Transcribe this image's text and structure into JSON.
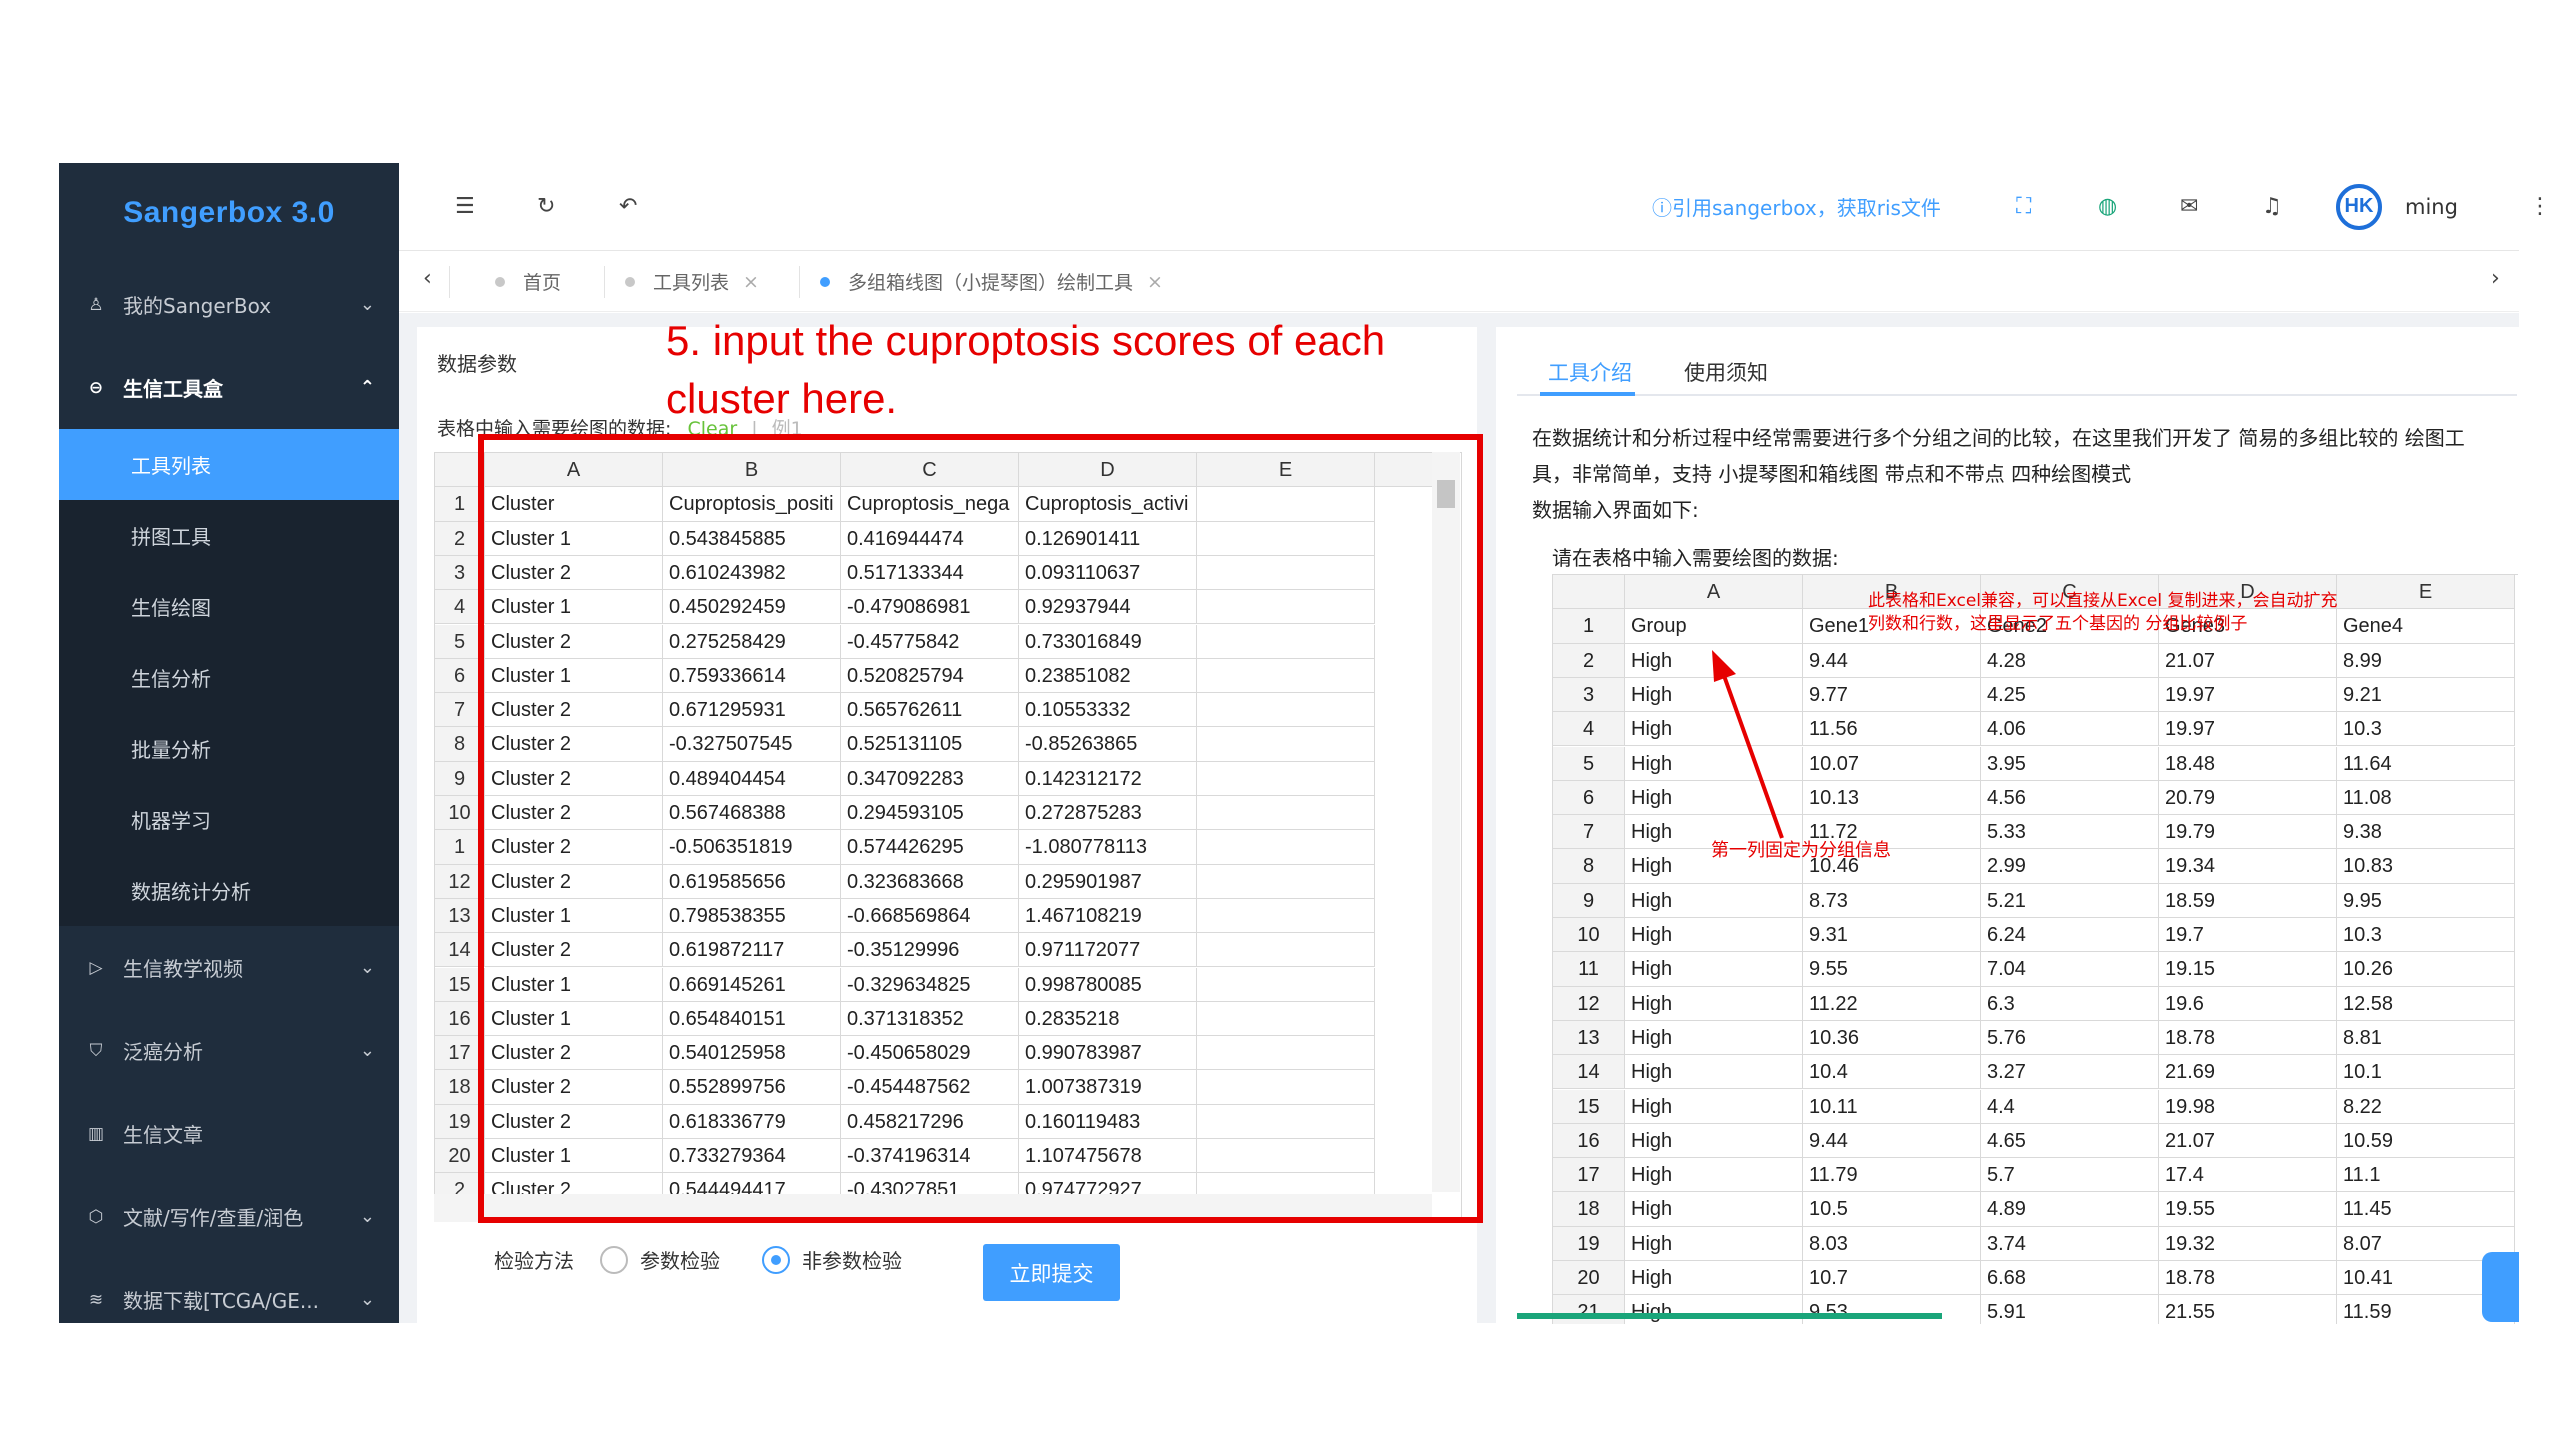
{
  "app": {
    "name": "Sangerbox 3.0"
  },
  "sidebar": {
    "items": [
      {
        "label": "我的SangerBox",
        "icon": "user-icon",
        "expanded": false
      },
      {
        "label": "生信工具盒",
        "icon": "toolbox-icon",
        "expanded": true,
        "children": [
          "工具列表",
          "拼图工具",
          "生信绘图",
          "生信分析",
          "批量分析",
          "机器学习",
          "数据统计分析"
        ]
      },
      {
        "label": "生信教学视频",
        "icon": "video-icon",
        "expanded": false
      },
      {
        "label": "泛癌分析",
        "icon": "shield-icon",
        "expanded": false
      },
      {
        "label": "生信文章",
        "icon": "book-icon",
        "expanded": null
      },
      {
        "label": "文献/写作/查重/润色",
        "icon": "cube-icon",
        "expanded": false
      },
      {
        "label": "数据下载[TCGA/GE...",
        "icon": "database-icon",
        "expanded": false
      }
    ],
    "active_child": "工具列表"
  },
  "header": {
    "cite_text": "ⓘ引用sangerbox，获取ris文件",
    "avatar_text": "HK",
    "username": "ming"
  },
  "tabs": [
    {
      "label": "首页",
      "closable": false,
      "active": false
    },
    {
      "label": "工具列表",
      "closable": true,
      "active": false
    },
    {
      "label": "多组箱线图（小提琴图）绘制工具",
      "closable": true,
      "active": true
    }
  ],
  "left_panel": {
    "title": "数据参数",
    "table_prompt": "表格中输入需要绘图的数据:",
    "clear_link": "Clear",
    "divider": "|",
    "example_link": "例1",
    "annotation": "5. input the cuproptosis scores of each cluster here.",
    "columns": [
      "A",
      "B",
      "C",
      "D",
      "E"
    ],
    "rows": [
      [
        "Cluster",
        "Cuproptosis_positi",
        "Cuproptosis_nega",
        "Cuproptosis_activi",
        ""
      ],
      [
        "Cluster 1",
        "0.543845885",
        "0.416944474",
        "0.126901411",
        ""
      ],
      [
        "Cluster 2",
        "0.610243982",
        "0.517133344",
        "0.093110637",
        ""
      ],
      [
        "Cluster 1",
        "0.450292459",
        "-0.479086981",
        "0.92937944",
        ""
      ],
      [
        "Cluster 2",
        "0.275258429",
        "-0.45775842",
        "0.733016849",
        ""
      ],
      [
        "Cluster 1",
        "0.759336614",
        "0.520825794",
        "0.23851082",
        ""
      ],
      [
        "Cluster 2",
        "0.671295931",
        "0.565762611",
        "0.10553332",
        ""
      ],
      [
        "Cluster 2",
        "-0.327507545",
        "0.525131105",
        "-0.85263865",
        ""
      ],
      [
        "Cluster 2",
        "0.489404454",
        "0.347092283",
        "0.142312172",
        ""
      ],
      [
        "Cluster 2",
        "0.567468388",
        "0.294593105",
        "0.272875283",
        ""
      ],
      [
        "Cluster 2",
        "-0.506351819",
        "0.574426295",
        "-1.080778113",
        ""
      ],
      [
        "Cluster 2",
        "0.619585656",
        "0.323683668",
        "0.295901987",
        ""
      ],
      [
        "Cluster 1",
        "0.798538355",
        "-0.668569864",
        "1.467108219",
        ""
      ],
      [
        "Cluster 2",
        "0.619872117",
        "-0.35129996",
        "0.971172077",
        ""
      ],
      [
        "Cluster 1",
        "0.669145261",
        "-0.329634825",
        "0.998780085",
        ""
      ],
      [
        "Cluster 1",
        "0.654840151",
        "0.371318352",
        "0.2835218",
        ""
      ],
      [
        "Cluster 2",
        "0.540125958",
        "-0.450658029",
        "0.990783987",
        ""
      ],
      [
        "Cluster 2",
        "0.552899756",
        "-0.454487562",
        "1.007387319",
        ""
      ],
      [
        "Cluster 2",
        "0.618336779",
        "0.458217296",
        "0.160119483",
        ""
      ],
      [
        "Cluster 1",
        "0.733279364",
        "-0.374196314",
        "1.107475678",
        ""
      ],
      [
        "Cluster 2",
        "0.544494417",
        "-0.43027851",
        "0.974772927",
        ""
      ]
    ],
    "row_numbers": [
      "1",
      "2",
      "3",
      "4",
      "5",
      "6",
      "7",
      "8",
      "9",
      "10",
      "1",
      "12",
      "13",
      "14",
      "15",
      "16",
      "17",
      "18",
      "19",
      "20",
      "2"
    ],
    "method_label": "检验方法",
    "method_options": [
      "参数检验",
      "非参数检验"
    ],
    "method_selected": "非参数检验",
    "submit_label": "立即提交"
  },
  "right_panel": {
    "tabs": [
      "工具介绍",
      "使用须知"
    ],
    "active_tab": "工具介绍",
    "intro_line1": "在数据统计和分析过程中经常需要进行多个分组之间的比较，在这里我们开发了 简易的多组比较的 绘图工",
    "intro_line2": "具，非常简单，支持 小提琴图和箱线图 带点和不带点 四种绘图模式",
    "intro_line3": "数据输入界面如下:",
    "example_title": "请在表格中输入需要绘图的数据:",
    "example_columns": [
      "A",
      "B",
      "C",
      "D",
      "E"
    ],
    "example_rows": [
      [
        "1",
        "Group",
        "Gene1",
        "Gene2",
        "Gene3",
        "Gene4"
      ],
      [
        "2",
        "High",
        "9.44",
        "4.28",
        "21.07",
        "8.99"
      ],
      [
        "3",
        "High",
        "9.77",
        "4.25",
        "19.97",
        "9.21"
      ],
      [
        "4",
        "High",
        "11.56",
        "4.06",
        "19.97",
        "10.3"
      ],
      [
        "5",
        "High",
        "10.07",
        "3.95",
        "18.48",
        "11.64"
      ],
      [
        "6",
        "High",
        "10.13",
        "4.56",
        "20.79",
        "11.08"
      ],
      [
        "7",
        "High",
        "11.72",
        "5.33",
        "19.79",
        "9.38"
      ],
      [
        "8",
        "High",
        "10.46",
        "2.99",
        "19.34",
        "10.83"
      ],
      [
        "9",
        "High",
        "8.73",
        "5.21",
        "18.59",
        "9.95"
      ],
      [
        "10",
        "High",
        "9.31",
        "6.24",
        "19.7",
        "10.3"
      ],
      [
        "11",
        "High",
        "9.55",
        "7.04",
        "19.15",
        "10.26"
      ],
      [
        "12",
        "High",
        "11.22",
        "6.3",
        "19.6",
        "12.58"
      ],
      [
        "13",
        "High",
        "10.36",
        "5.76",
        "18.78",
        "8.81"
      ],
      [
        "14",
        "High",
        "10.4",
        "3.27",
        "21.69",
        "10.1"
      ],
      [
        "15",
        "High",
        "10.11",
        "4.4",
        "19.98",
        "8.22"
      ],
      [
        "16",
        "High",
        "9.44",
        "4.65",
        "21.07",
        "10.59"
      ],
      [
        "17",
        "High",
        "11.79",
        "5.7",
        "17.4",
        "11.1"
      ],
      [
        "18",
        "High",
        "10.5",
        "4.89",
        "19.55",
        "11.45"
      ],
      [
        "19",
        "High",
        "8.03",
        "3.74",
        "19.32",
        "8.07"
      ],
      [
        "20",
        "High",
        "10.7",
        "6.68",
        "18.78",
        "10.41"
      ],
      [
        "21",
        "High",
        "9.53",
        "5.91",
        "21.55",
        "11.59"
      ]
    ],
    "note_excel": "此表格和Excel兼容，可以直接从Excel 复制进来，会自动扩充列数和行数，这里显示了五个基因的 分组比较例子",
    "note_group": "第一列固定为分组信息"
  },
  "colors": {
    "accent": "#409eff",
    "sidebar_bg": "#1f2d3d",
    "annotation_red": "#e60000"
  }
}
